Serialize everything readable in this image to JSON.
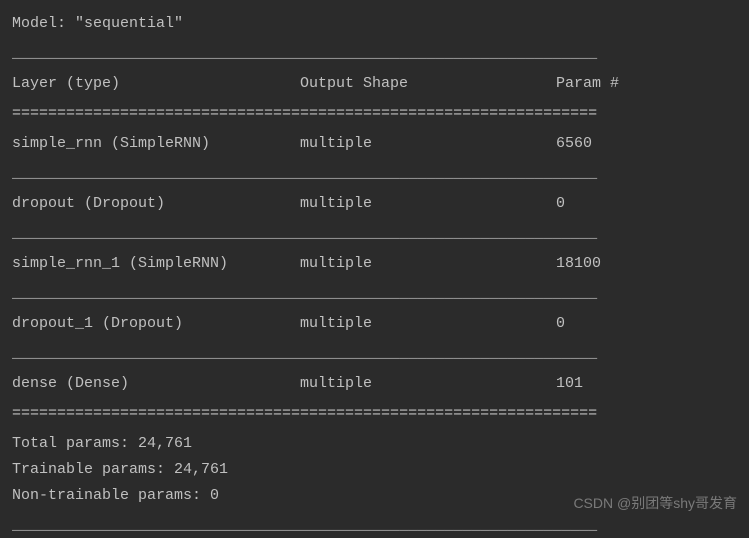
{
  "model_line": "Model: \"sequential\"",
  "headers": {
    "layer": "Layer (type)",
    "output": "Output Shape",
    "param": "Param #"
  },
  "rows": [
    {
      "layer": "simple_rnn (SimpleRNN)",
      "output": "multiple",
      "param": "6560"
    },
    {
      "layer": "dropout (Dropout)",
      "output": "multiple",
      "param": "0"
    },
    {
      "layer": "simple_rnn_1 (SimpleRNN)",
      "output": "multiple",
      "param": "18100"
    },
    {
      "layer": "dropout_1 (Dropout)",
      "output": "multiple",
      "param": "0"
    },
    {
      "layer": "dense (Dense)",
      "output": "multiple",
      "param": "101"
    }
  ],
  "summary": {
    "total": "Total params: 24,761",
    "trainable": "Trainable params: 24,761",
    "non_trainable": "Non-trainable params: 0"
  },
  "divider_thin": "_________________________________________________________________",
  "divider_thick": "=================================================================",
  "watermark": "CSDN @别团等shy哥发育"
}
